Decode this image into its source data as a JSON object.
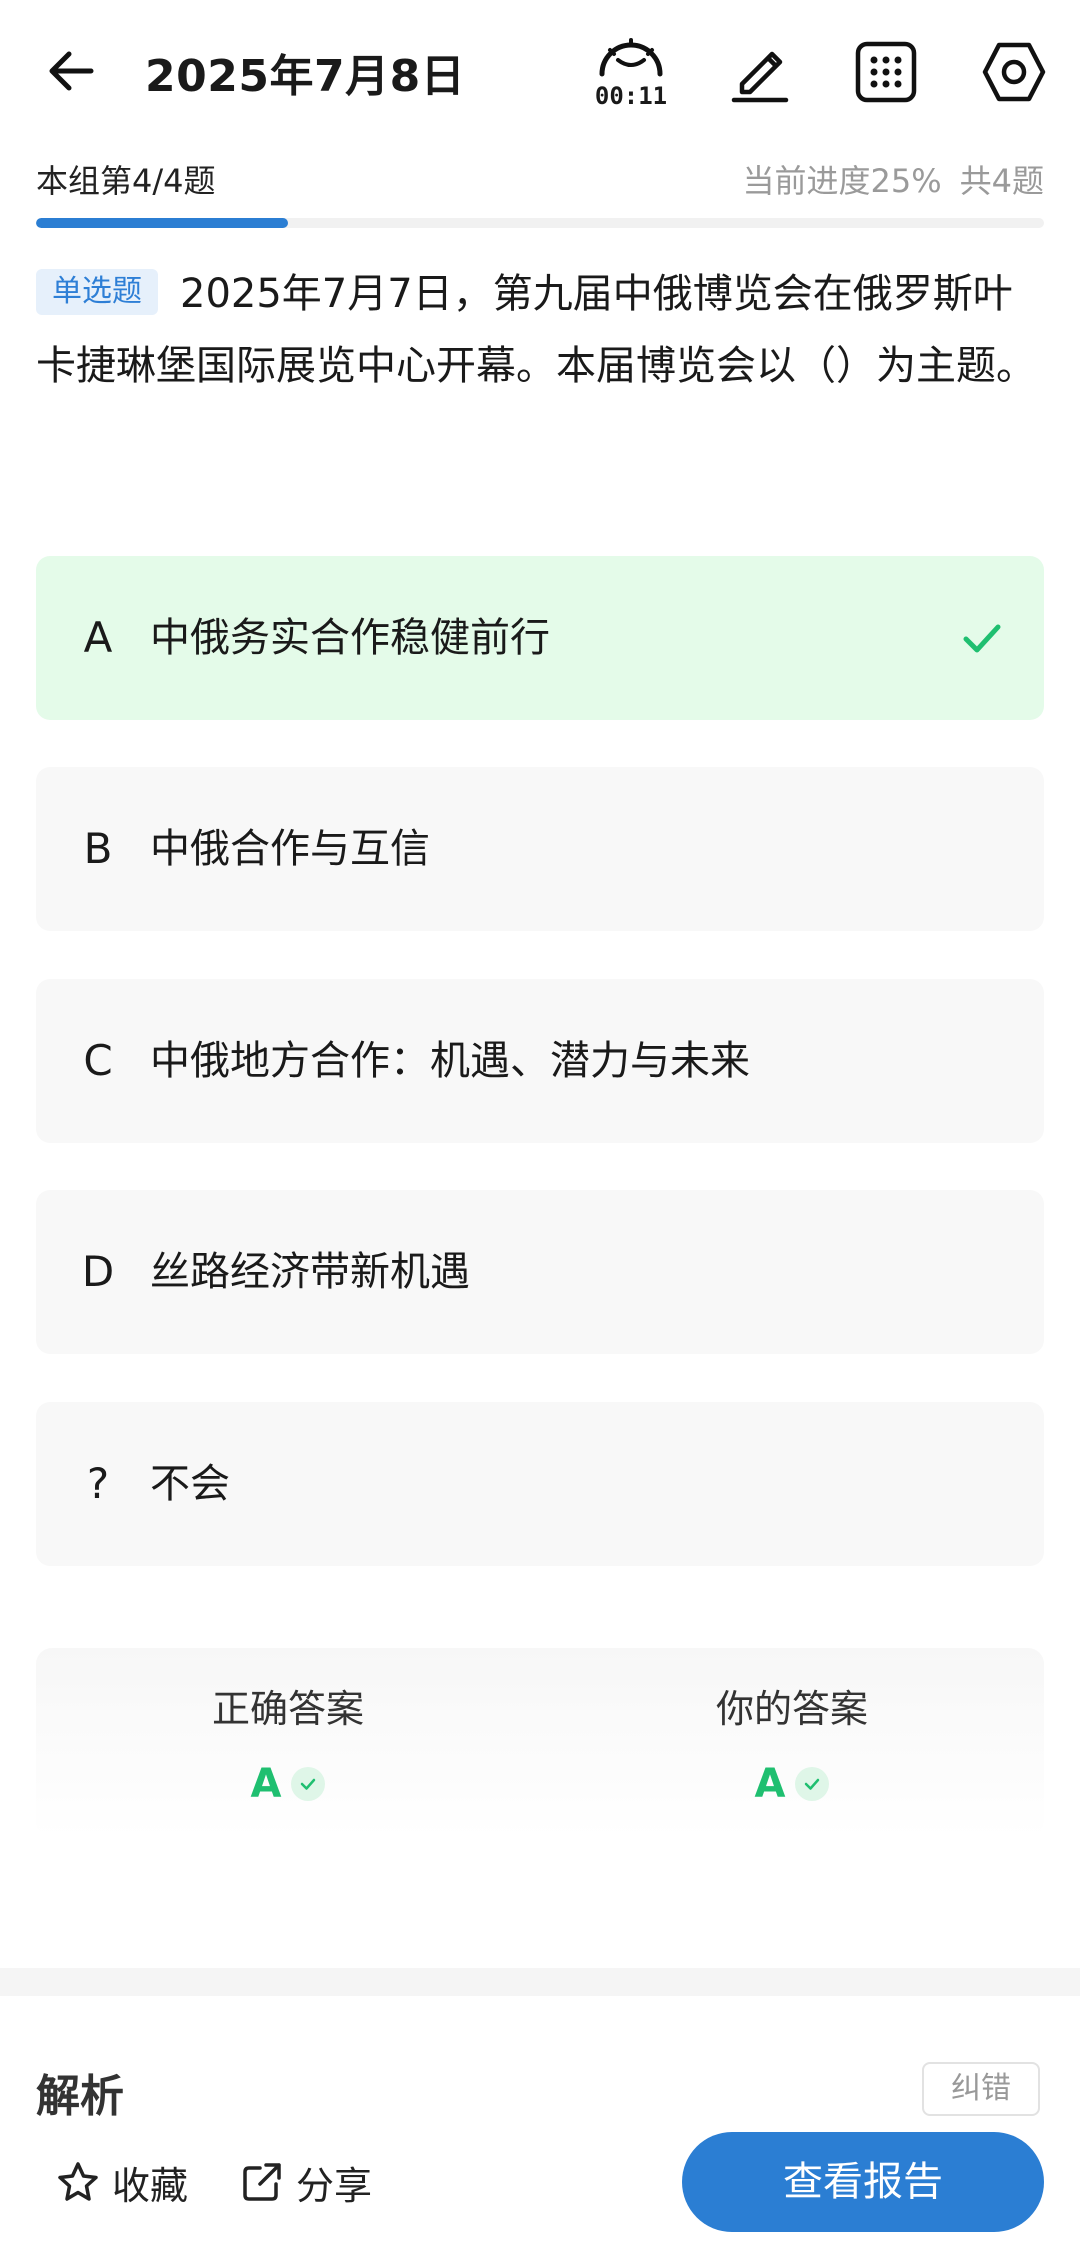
{
  "header": {
    "title": "2025年7月8日",
    "timer": "00:11"
  },
  "progress": {
    "group_label": "本组第4/4题",
    "current_progress": "当前进度25%",
    "total": "共4题",
    "fraction": 0.25
  },
  "question": {
    "type_badge": "单选题",
    "text": "2025年7月7日，第九届中俄博览会在俄罗斯叶卡捷琳堡国际展览中心开幕。本届博览会以（）为主题。"
  },
  "options": [
    {
      "letter": "A",
      "text": "中俄务实合作稳健前行",
      "state": "correct"
    },
    {
      "letter": "B",
      "text": "中俄合作与互信",
      "state": "normal"
    },
    {
      "letter": "C",
      "text": "中俄地方合作：机遇、潜力与未来",
      "state": "normal"
    },
    {
      "letter": "D",
      "text": "丝路经济带新机遇",
      "state": "normal"
    },
    {
      "letter": "?",
      "text": "不会",
      "state": "normal"
    }
  ],
  "answers": {
    "correct_label": "正确答案",
    "correct_value": "A",
    "yours_label": "你的答案",
    "yours_value": "A"
  },
  "analysis": {
    "title": "解析",
    "report_error": "纠错"
  },
  "bottom": {
    "favorite": "收藏",
    "share": "分享",
    "view_report": "查看报告"
  },
  "colors": {
    "accent": "#2b7ed3",
    "correct": "#1fbf70",
    "correct_bg": "#e4fbe9",
    "option_bg": "#f8f8f8"
  },
  "icons": {
    "back": "arrow-left-icon",
    "timer": "stopwatch-icon",
    "edit": "pencil-icon",
    "grid": "grid-icon",
    "settings": "hexagon-gear-icon",
    "check": "check-icon",
    "favorite": "star-icon",
    "share": "share-icon"
  }
}
